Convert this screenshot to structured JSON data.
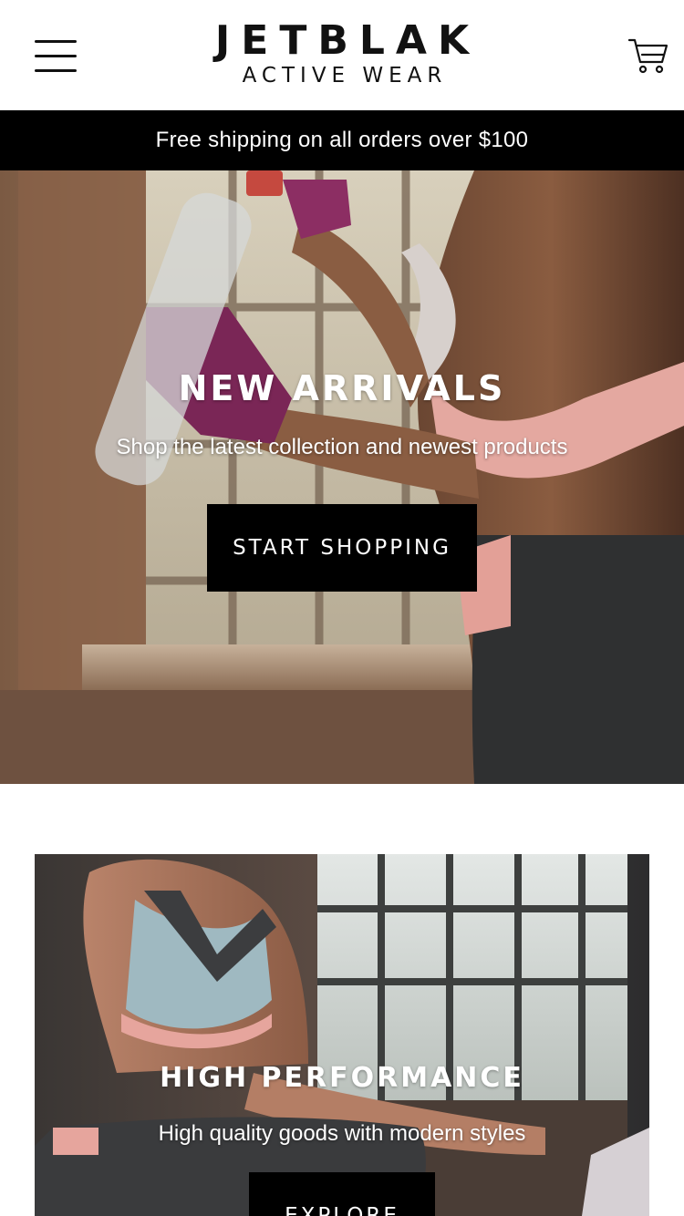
{
  "header": {
    "brand": "JETBLAK",
    "tagline": "ACTIVE WEAR",
    "menu_icon": "hamburger-menu-icon",
    "cart_icon": "shopping-cart-icon"
  },
  "announcement": {
    "text": "Free shipping on all orders over $100"
  },
  "hero": {
    "title": "NEW ARRIVALS",
    "subtitle": "Shop the latest collection and newest products",
    "cta": "START SHOPPING"
  },
  "feature": {
    "title": "HIGH PERFORMANCE",
    "subtitle": "High quality goods with modern styles",
    "cta": "EXPLORE"
  },
  "colors": {
    "primary": "#000000",
    "background": "#ffffff",
    "text_on_dark": "#ffffff"
  }
}
